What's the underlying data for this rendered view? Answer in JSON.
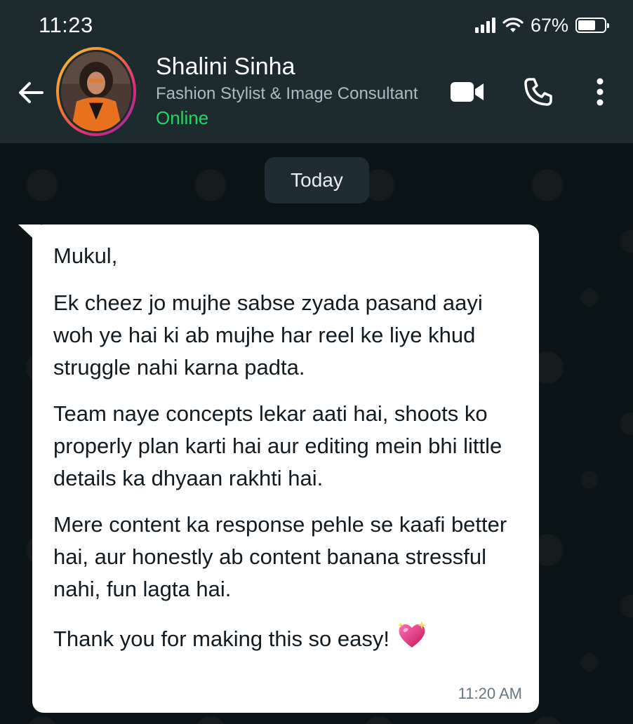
{
  "status_bar": {
    "time": "11:23",
    "battery_percent": "67%",
    "battery_level": 0.67,
    "icons": [
      "signal-icon",
      "wifi-icon",
      "battery-icon"
    ]
  },
  "header": {
    "back_icon": "arrow-left-icon",
    "contact": {
      "name": "Shalini Sinha",
      "subtitle": "Fashion Stylist & Image Consultant",
      "status": "Online"
    },
    "actions": [
      "video-call-icon",
      "voice-call-icon",
      "more-options-icon"
    ]
  },
  "chat": {
    "date_separator": "Today",
    "message": {
      "greeting": "Mukul,",
      "paragraphs": [
        "Ek cheez jo mujhe sabse zyada pasand aayi woh ye hai ki ab mujhe har reel ke liye khud struggle nahi karna padta.",
        "Team naye concepts lekar aati hai, shoots ko properly plan karti hai aur editing mein bhi little details ka dhyaan rakhti hai.",
        "Mere content ka response pehle se kaafi better hai, aur honestly ab content banana stressful nahi, fun lagta hai."
      ],
      "closing": "Thank you for making this so easy!",
      "emoji": "sparkling-heart-icon",
      "time": "11:20 AM"
    }
  },
  "colors": {
    "header_bg": "#1d2b2f",
    "chat_bg": "#0b1416",
    "bubble_bg": "#ffffff",
    "online_green": "#25d366",
    "heart_pink": "#e0408a"
  }
}
